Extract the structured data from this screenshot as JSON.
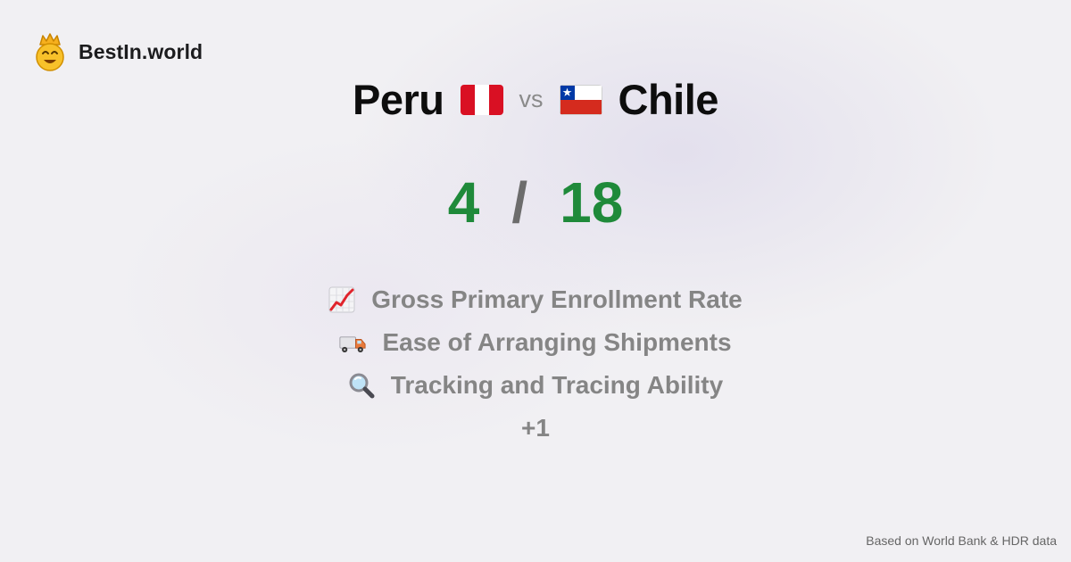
{
  "brand": {
    "logo_icon": "crown-smiley-icon",
    "name": "BestIn.world"
  },
  "comparison": {
    "left_country": "Peru",
    "left_flag_icon": "peru-flag-icon",
    "vs_label": "vs",
    "right_country": "Chile",
    "right_flag_icon": "chile-flag-icon"
  },
  "score": {
    "left": "4",
    "separator": "/",
    "right": "18",
    "color": "#1f8a3a"
  },
  "metrics": [
    {
      "icon": "chart-increasing-icon",
      "label": "Gross Primary Enrollment Rate"
    },
    {
      "icon": "delivery-truck-icon",
      "label": "Ease of Arranging Shipments"
    },
    {
      "icon": "magnifying-glass-icon",
      "label": "Tracking and Tracing Ability"
    }
  ],
  "more_label": "+1",
  "footer": {
    "source_text": "Based on World Bank & HDR data"
  }
}
